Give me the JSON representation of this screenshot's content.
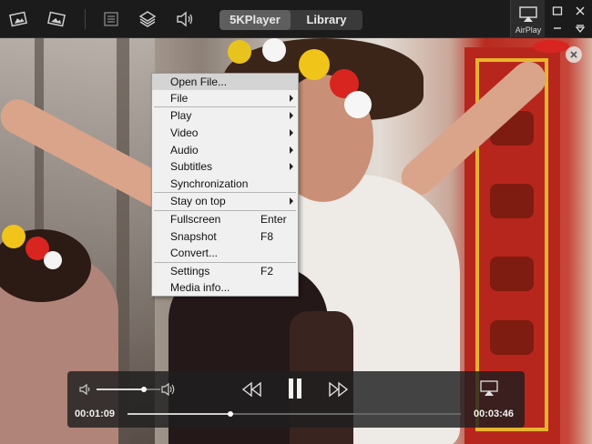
{
  "app": {
    "tabs": [
      {
        "label": "5KPlayer",
        "active": true
      },
      {
        "label": "Library",
        "active": false
      }
    ],
    "airplay_label": "AirPlay"
  },
  "context_menu": {
    "items": [
      {
        "label": "Open File...",
        "shortcut": "",
        "submenu": false,
        "highlighted": true
      },
      {
        "label": "File",
        "shortcut": "",
        "submenu": true
      },
      {
        "label": "Play",
        "shortcut": "",
        "submenu": true
      },
      {
        "label": "Video",
        "shortcut": "",
        "submenu": true
      },
      {
        "label": "Audio",
        "shortcut": "",
        "submenu": true
      },
      {
        "label": "Subtitles",
        "shortcut": "",
        "submenu": true
      },
      {
        "label": "Synchronization",
        "shortcut": "",
        "submenu": false
      },
      {
        "label": "Stay on top",
        "shortcut": "",
        "submenu": true
      },
      {
        "label": "Fullscreen",
        "shortcut": "Enter",
        "submenu": false
      },
      {
        "label": "Snapshot",
        "shortcut": "F8",
        "submenu": false
      },
      {
        "label": "Convert...",
        "shortcut": "",
        "submenu": false
      },
      {
        "label": "Settings",
        "shortcut": "F2",
        "submenu": false
      },
      {
        "label": "Media info...",
        "shortcut": "",
        "submenu": false
      }
    ]
  },
  "player": {
    "elapsed": "00:01:09",
    "duration": "00:03:46",
    "progress_fraction": 0.31,
    "volume_fraction": 0.74
  },
  "colors": {
    "topbar_bg": "#1b1b1b",
    "menu_bg": "#f0f0f0",
    "menu_highlight": "#d4d4d4",
    "controls_bg": "#1e1e1e"
  }
}
